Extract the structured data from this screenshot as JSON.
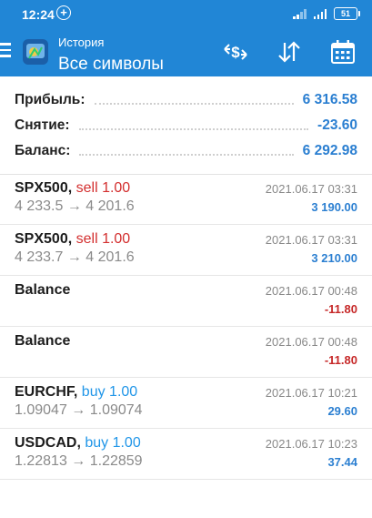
{
  "status_bar": {
    "time": "12:24",
    "battery": "51"
  },
  "toolbar": {
    "subtitle": "История",
    "title": "Все символы"
  },
  "colors": {
    "header_bg": "#2186d6",
    "accent_blue": "#2b7fd1",
    "sell_red": "#d32f2f",
    "buy_blue": "#2196e8",
    "negative_red": "#c62828"
  },
  "icons": [
    "menu-icon",
    "app-logo-icon",
    "currency-exchange-icon",
    "sort-icon",
    "calendar-icon"
  ],
  "summary": [
    {
      "label": "Прибыль:",
      "value": "6 316.58"
    },
    {
      "label": "Снятие:",
      "value": "-23.60"
    },
    {
      "label": "Баланс:",
      "value": "6 292.98"
    }
  ],
  "deals": [
    {
      "symbol": "SPX500,",
      "dir": "sell 1.00",
      "dir_type": "sell",
      "prices": "4 233.5 → 4 201.6",
      "time": "2021.06.17 03:31",
      "profit": "3 190.00",
      "profit_type": "pos"
    },
    {
      "symbol": "SPX500,",
      "dir": "sell 1.00",
      "dir_type": "sell",
      "prices": "4 233.7 → 4 201.6",
      "time": "2021.06.17 03:31",
      "profit": "3 210.00",
      "profit_type": "pos"
    },
    {
      "symbol": "Balance",
      "dir": "",
      "dir_type": "",
      "prices": "",
      "time": "2021.06.17 00:48",
      "profit": "-11.80",
      "profit_type": "neg"
    },
    {
      "symbol": "Balance",
      "dir": "",
      "dir_type": "",
      "prices": "",
      "time": "2021.06.17 00:48",
      "profit": "-11.80",
      "profit_type": "neg"
    },
    {
      "symbol": "EURCHF,",
      "dir": "buy 1.00",
      "dir_type": "buy",
      "prices": "1.09047 → 1.09074",
      "time": "2021.06.17 10:21",
      "profit": "29.60",
      "profit_type": "pos"
    },
    {
      "symbol": "USDCAD,",
      "dir": "buy 1.00",
      "dir_type": "buy",
      "prices": "1.22813 → 1.22859",
      "time": "2021.06.17 10:23",
      "profit": "37.44",
      "profit_type": "pos"
    }
  ]
}
